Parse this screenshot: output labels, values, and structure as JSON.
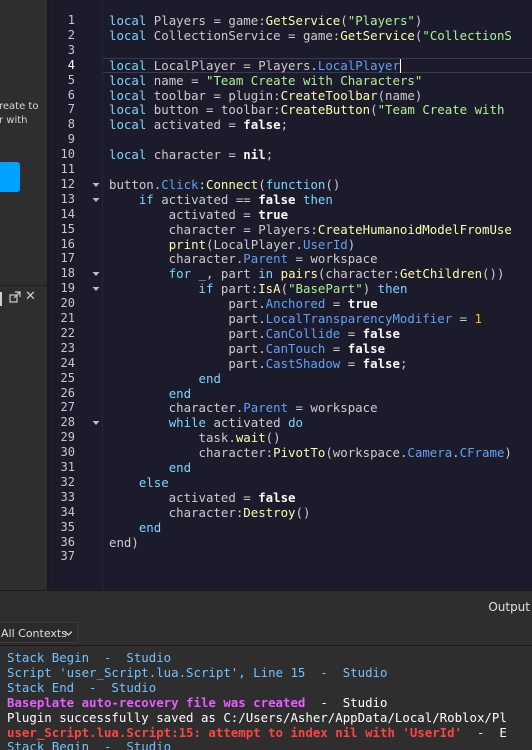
{
  "left_panel": {
    "hint_text": "reate to\nr with"
  },
  "editor": {
    "active_line": 4,
    "lines": [
      {
        "n": 1,
        "tokens": [
          [
            "kw2",
            "local"
          ],
          [
            "id",
            " Players = game:"
          ],
          [
            "method",
            "GetService"
          ],
          [
            "id",
            "("
          ],
          [
            "str",
            "\"Players\""
          ],
          [
            "id",
            ")"
          ]
        ]
      },
      {
        "n": 2,
        "tokens": [
          [
            "kw2",
            "local"
          ],
          [
            "id",
            " CollectionService = game:"
          ],
          [
            "method",
            "GetService"
          ],
          [
            "id",
            "("
          ],
          [
            "str",
            "\"CollectionS"
          ]
        ]
      },
      {
        "n": 3,
        "tokens": []
      },
      {
        "n": 4,
        "tokens": [
          [
            "kw2",
            "local"
          ],
          [
            "id",
            " LocalPlayer = Players."
          ],
          [
            "prop",
            "LocalPlayer"
          ]
        ]
      },
      {
        "n": 5,
        "tokens": [
          [
            "kw2",
            "local"
          ],
          [
            "id",
            " name = "
          ],
          [
            "str",
            "\"Team Create with Characters\""
          ]
        ]
      },
      {
        "n": 6,
        "tokens": [
          [
            "kw2",
            "local"
          ],
          [
            "id",
            " toolbar = plugin:"
          ],
          [
            "method",
            "CreateToolbar"
          ],
          [
            "id",
            "(name)"
          ]
        ]
      },
      {
        "n": 7,
        "tokens": [
          [
            "kw2",
            "local"
          ],
          [
            "id",
            " button = toolbar:"
          ],
          [
            "method",
            "CreateButton"
          ],
          [
            "id",
            "("
          ],
          [
            "str",
            "\"Team Create with "
          ]
        ]
      },
      {
        "n": 8,
        "tokens": [
          [
            "kw2",
            "local"
          ],
          [
            "id",
            " activated = "
          ],
          [
            "kwb",
            "false"
          ],
          [
            "id",
            ";"
          ]
        ]
      },
      {
        "n": 9,
        "tokens": []
      },
      {
        "n": 10,
        "tokens": [
          [
            "kw2",
            "local"
          ],
          [
            "id",
            " character = "
          ],
          [
            "kwb",
            "nil"
          ],
          [
            "id",
            ";"
          ]
        ]
      },
      {
        "n": 11,
        "tokens": []
      },
      {
        "n": 12,
        "tokens": [
          [
            "id",
            "button."
          ],
          [
            "prop",
            "Click"
          ],
          [
            "id",
            ":"
          ],
          [
            "method",
            "Connect"
          ],
          [
            "id",
            "("
          ],
          [
            "kw2",
            "function"
          ],
          [
            "id",
            "()"
          ]
        ]
      },
      {
        "n": 13,
        "tokens": [
          [
            "id",
            "    "
          ],
          [
            "kw2",
            "if"
          ],
          [
            "id",
            " activated == "
          ],
          [
            "kwb",
            "false"
          ],
          [
            "id",
            " "
          ],
          [
            "kw2",
            "then"
          ]
        ]
      },
      {
        "n": 14,
        "tokens": [
          [
            "id",
            "        activated = "
          ],
          [
            "kwb",
            "true"
          ]
        ]
      },
      {
        "n": 15,
        "tokens": [
          [
            "id",
            "        character = Players:"
          ],
          [
            "method",
            "CreateHumanoidModelFromUse"
          ]
        ]
      },
      {
        "n": 16,
        "tokens": [
          [
            "id",
            "        "
          ],
          [
            "method",
            "print"
          ],
          [
            "id",
            "(LocalPlayer."
          ],
          [
            "prop",
            "UserId"
          ],
          [
            "id",
            ")"
          ]
        ]
      },
      {
        "n": 17,
        "tokens": [
          [
            "id",
            "        character."
          ],
          [
            "prop",
            "Parent"
          ],
          [
            "id",
            " = workspace"
          ]
        ]
      },
      {
        "n": 18,
        "tokens": [
          [
            "id",
            "        "
          ],
          [
            "kw2",
            "for"
          ],
          [
            "id",
            " _, part "
          ],
          [
            "kw2",
            "in"
          ],
          [
            "id",
            " "
          ],
          [
            "method",
            "pairs"
          ],
          [
            "id",
            "(character:"
          ],
          [
            "method",
            "GetChildren"
          ],
          [
            "id",
            "())"
          ]
        ]
      },
      {
        "n": 19,
        "tokens": [
          [
            "id",
            "            "
          ],
          [
            "kw2",
            "if"
          ],
          [
            "id",
            " part:"
          ],
          [
            "method",
            "IsA"
          ],
          [
            "id",
            "("
          ],
          [
            "str",
            "\"BasePart\""
          ],
          [
            "id",
            ") "
          ],
          [
            "kw2",
            "then"
          ]
        ]
      },
      {
        "n": 20,
        "tokens": [
          [
            "id",
            "                part."
          ],
          [
            "prop",
            "Anchored"
          ],
          [
            "id",
            " = "
          ],
          [
            "kwb",
            "true"
          ]
        ]
      },
      {
        "n": 21,
        "tokens": [
          [
            "id",
            "                part."
          ],
          [
            "prop",
            "LocalTransparencyModifier"
          ],
          [
            "id",
            " = "
          ],
          [
            "num",
            "1"
          ]
        ]
      },
      {
        "n": 22,
        "tokens": [
          [
            "id",
            "                part."
          ],
          [
            "prop",
            "CanCollide"
          ],
          [
            "id",
            " = "
          ],
          [
            "kwb",
            "false"
          ]
        ]
      },
      {
        "n": 23,
        "tokens": [
          [
            "id",
            "                part."
          ],
          [
            "prop",
            "CanTouch"
          ],
          [
            "id",
            " = "
          ],
          [
            "kwb",
            "false"
          ]
        ]
      },
      {
        "n": 24,
        "tokens": [
          [
            "id",
            "                part."
          ],
          [
            "prop",
            "CastShadow"
          ],
          [
            "id",
            " = "
          ],
          [
            "kwb",
            "false"
          ],
          [
            "id",
            ";"
          ]
        ]
      },
      {
        "n": 25,
        "tokens": [
          [
            "id",
            "            "
          ],
          [
            "kw2",
            "end"
          ]
        ]
      },
      {
        "n": 26,
        "tokens": [
          [
            "id",
            "        "
          ],
          [
            "kw2",
            "end"
          ]
        ]
      },
      {
        "n": 27,
        "tokens": [
          [
            "id",
            "        character."
          ],
          [
            "prop",
            "Parent"
          ],
          [
            "id",
            " = workspace"
          ]
        ]
      },
      {
        "n": 28,
        "tokens": [
          [
            "id",
            "        "
          ],
          [
            "kw2",
            "while"
          ],
          [
            "id",
            " activated "
          ],
          [
            "kw2",
            "do"
          ]
        ]
      },
      {
        "n": 29,
        "tokens": [
          [
            "id",
            "            task."
          ],
          [
            "method",
            "wait"
          ],
          [
            "id",
            "()"
          ]
        ]
      },
      {
        "n": 30,
        "tokens": [
          [
            "id",
            "            character:"
          ],
          [
            "method",
            "PivotTo"
          ],
          [
            "id",
            "(workspace."
          ],
          [
            "prop",
            "Camera"
          ],
          [
            "id",
            "."
          ],
          [
            "prop",
            "CFrame"
          ],
          [
            "id",
            ")"
          ]
        ]
      },
      {
        "n": 31,
        "tokens": [
          [
            "id",
            "        "
          ],
          [
            "kw2",
            "end"
          ]
        ]
      },
      {
        "n": 32,
        "tokens": [
          [
            "id",
            "    "
          ],
          [
            "kw2",
            "else"
          ]
        ]
      },
      {
        "n": 33,
        "tokens": [
          [
            "id",
            "        activated = "
          ],
          [
            "kwb",
            "false"
          ]
        ]
      },
      {
        "n": 34,
        "tokens": [
          [
            "id",
            "        character:"
          ],
          [
            "method",
            "Destroy"
          ],
          [
            "id",
            "()"
          ]
        ]
      },
      {
        "n": 35,
        "tokens": [
          [
            "id",
            "    "
          ],
          [
            "kw2",
            "end"
          ]
        ]
      },
      {
        "n": 36,
        "tokens": [
          [
            "id",
            "end)"
          ]
        ]
      },
      {
        "n": 37,
        "tokens": []
      }
    ],
    "fold_lines": [
      12,
      13,
      18,
      19,
      28
    ]
  },
  "output": {
    "title": "Output",
    "context_select": "All Contexts",
    "entries": [
      {
        "kind": "info",
        "text": "Stack Begin  -  Studio"
      },
      {
        "kind": "info",
        "text": "Script 'user_Script.lua.Script', Line 15  -  Studio"
      },
      {
        "kind": "info",
        "text": "Stack End  -  Studio"
      },
      {
        "kind": "warn-purple",
        "text": "Baseplate auto-recovery file was created",
        "src": "  -  Studio"
      },
      {
        "kind": "normal",
        "text": "Plugin successfully saved as C:/Users/Asher/AppData/Local/Roblox/Pl"
      },
      {
        "kind": "err",
        "text": "user_Script.lua.Script:15: attempt to index nil with 'UserId'",
        "src": "  -  E"
      },
      {
        "kind": "info",
        "text": "Stack Begin  -  Studio"
      }
    ]
  }
}
